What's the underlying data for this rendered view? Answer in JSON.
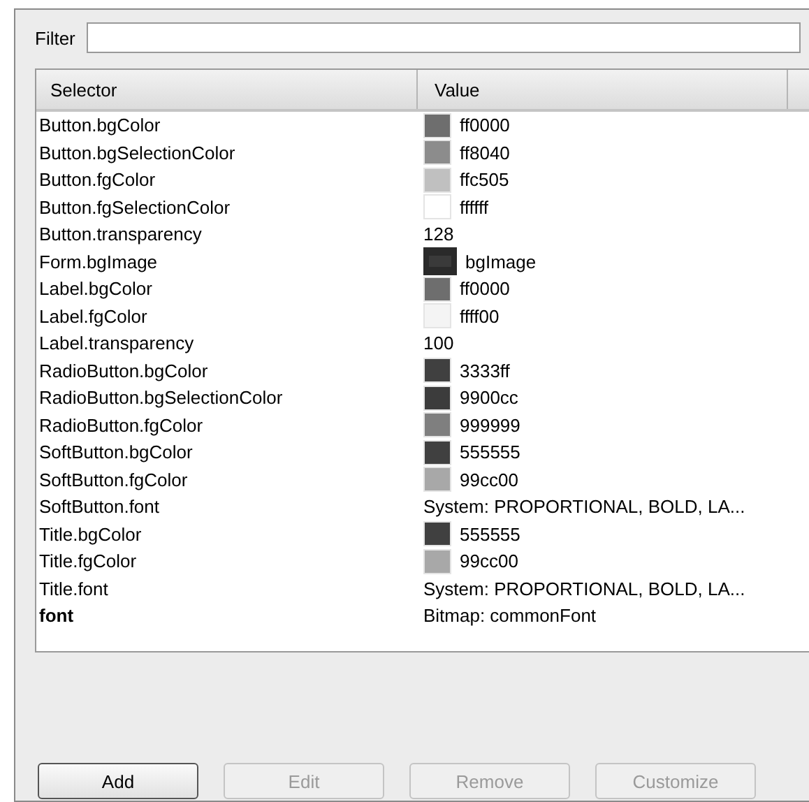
{
  "filter": {
    "label": "Filter"
  },
  "table": {
    "columns": [
      "Selector",
      "Value"
    ],
    "rows": [
      {
        "selector": "Button.bgColor",
        "kind": "color",
        "color": "#6e6e6e",
        "value": "ff0000",
        "bold": false
      },
      {
        "selector": "Button.bgSelectionColor",
        "kind": "color",
        "color": "#8c8c8c",
        "value": "ff8040",
        "bold": false
      },
      {
        "selector": "Button.fgColor",
        "kind": "color",
        "color": "#c0c0c0",
        "value": "ffc505",
        "bold": false
      },
      {
        "selector": "Button.fgSelectionColor",
        "kind": "color",
        "color": "#ffffff",
        "value": "ffffff",
        "bold": false
      },
      {
        "selector": "Button.transparency",
        "kind": "text",
        "value": "128",
        "bold": false
      },
      {
        "selector": "Form.bgImage",
        "kind": "image",
        "value": "bgImage",
        "bold": false
      },
      {
        "selector": "Label.bgColor",
        "kind": "color",
        "color": "#6e6e6e",
        "value": "ff0000",
        "bold": false
      },
      {
        "selector": "Label.fgColor",
        "kind": "color",
        "color": "#f4f4f4",
        "value": "ffff00",
        "bold": false
      },
      {
        "selector": "Label.transparency",
        "kind": "text",
        "value": "100",
        "bold": false
      },
      {
        "selector": "RadioButton.bgColor",
        "kind": "color",
        "color": "#404040",
        "value": "3333ff",
        "bold": false
      },
      {
        "selector": "RadioButton.bgSelectionColor",
        "kind": "color",
        "color": "#3c3c3c",
        "value": "9900cc",
        "bold": false
      },
      {
        "selector": "RadioButton.fgColor",
        "kind": "color",
        "color": "#7f7f7f",
        "value": "999999",
        "bold": false
      },
      {
        "selector": "SoftButton.bgColor",
        "kind": "color",
        "color": "#404040",
        "value": "555555",
        "bold": false
      },
      {
        "selector": "SoftButton.fgColor",
        "kind": "color",
        "color": "#a8a8a8",
        "value": "99cc00",
        "bold": false
      },
      {
        "selector": "SoftButton.font",
        "kind": "text",
        "value": "System: PROPORTIONAL, BOLD, LA...",
        "bold": false
      },
      {
        "selector": "Title.bgColor",
        "kind": "color",
        "color": "#404040",
        "value": "555555",
        "bold": false
      },
      {
        "selector": "Title.fgColor",
        "kind": "color",
        "color": "#a8a8a8",
        "value": "99cc00",
        "bold": false
      },
      {
        "selector": "Title.font",
        "kind": "text",
        "value": "System: PROPORTIONAL, BOLD, LA...",
        "bold": false
      },
      {
        "selector": "font",
        "kind": "text",
        "value": "Bitmap: commonFont",
        "bold": true
      }
    ]
  },
  "buttons": [
    {
      "label": "Add",
      "disabled": false
    },
    {
      "label": "Edit",
      "disabled": true
    },
    {
      "label": "Remove",
      "disabled": true
    },
    {
      "label": "Customize",
      "disabled": true
    }
  ]
}
